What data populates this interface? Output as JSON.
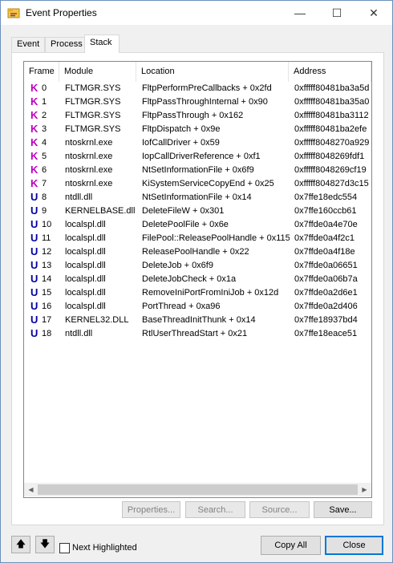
{
  "window": {
    "title": "Event Properties",
    "minimize_glyph": "—",
    "maximize_glyph": "☐",
    "close_glyph": "✕"
  },
  "tabs": [
    {
      "label": "Event",
      "active": false
    },
    {
      "label": "Process",
      "active": false
    },
    {
      "label": "Stack",
      "active": true
    }
  ],
  "list": {
    "columns": [
      "Frame",
      "Module",
      "Location",
      "Address"
    ],
    "rows": [
      {
        "mode": "K",
        "frame": "0",
        "module": "FLTMGR.SYS",
        "location": "FltpPerformPreCallbacks + 0x2fd",
        "address": "0xfffff80481ba3a5d"
      },
      {
        "mode": "K",
        "frame": "1",
        "module": "FLTMGR.SYS",
        "location": "FltpPassThroughInternal + 0x90",
        "address": "0xfffff80481ba35a0"
      },
      {
        "mode": "K",
        "frame": "2",
        "module": "FLTMGR.SYS",
        "location": "FltpPassThrough + 0x162",
        "address": "0xfffff80481ba3112"
      },
      {
        "mode": "K",
        "frame": "3",
        "module": "FLTMGR.SYS",
        "location": "FltpDispatch + 0x9e",
        "address": "0xfffff80481ba2efe"
      },
      {
        "mode": "K",
        "frame": "4",
        "module": "ntoskrnl.exe",
        "location": "IofCallDriver + 0x59",
        "address": "0xfffff8048270a929"
      },
      {
        "mode": "K",
        "frame": "5",
        "module": "ntoskrnl.exe",
        "location": "IopCallDriverReference + 0xf1",
        "address": "0xfffff8048269fdf1"
      },
      {
        "mode": "K",
        "frame": "6",
        "module": "ntoskrnl.exe",
        "location": "NtSetInformationFile + 0x6f9",
        "address": "0xfffff8048269cf19"
      },
      {
        "mode": "K",
        "frame": "7",
        "module": "ntoskrnl.exe",
        "location": "KiSystemServiceCopyEnd + 0x25",
        "address": "0xfffff804827d3c15"
      },
      {
        "mode": "U",
        "frame": "8",
        "module": "ntdll.dll",
        "location": "NtSetInformationFile + 0x14",
        "address": "0x7ffe18edc554"
      },
      {
        "mode": "U",
        "frame": "9",
        "module": "KERNELBASE.dll",
        "location": "DeleteFileW + 0x301",
        "address": "0x7ffe160ccb61"
      },
      {
        "mode": "U",
        "frame": "10",
        "module": "localspl.dll",
        "location": "DeletePoolFile + 0x6e",
        "address": "0x7ffde0a4e70e"
      },
      {
        "mode": "U",
        "frame": "11",
        "module": "localspl.dll",
        "location": "FilePool::ReleasePoolHandle + 0x115",
        "address": "0x7ffde0a4f2c1"
      },
      {
        "mode": "U",
        "frame": "12",
        "module": "localspl.dll",
        "location": "ReleasePoolHandle + 0x22",
        "address": "0x7ffde0a4f18e"
      },
      {
        "mode": "U",
        "frame": "13",
        "module": "localspl.dll",
        "location": "DeleteJob + 0x6f9",
        "address": "0x7ffde0a06651"
      },
      {
        "mode": "U",
        "frame": "14",
        "module": "localspl.dll",
        "location": "DeleteJobCheck + 0x1a",
        "address": "0x7ffde0a06b7a"
      },
      {
        "mode": "U",
        "frame": "15",
        "module": "localspl.dll",
        "location": "RemoveIniPortFromIniJob + 0x12d",
        "address": "0x7ffde0a2d6e1"
      },
      {
        "mode": "U",
        "frame": "16",
        "module": "localspl.dll",
        "location": "PortThread + 0xa96",
        "address": "0x7ffde0a2d406"
      },
      {
        "mode": "U",
        "frame": "17",
        "module": "KERNEL32.DLL",
        "location": "BaseThreadInitThunk + 0x14",
        "address": "0x7ffe18937bd4"
      },
      {
        "mode": "U",
        "frame": "18",
        "module": "ntdll.dll",
        "location": "RtlUserThreadStart + 0x21",
        "address": "0x7ffe18eace51"
      }
    ]
  },
  "panel_buttons": {
    "properties": "Properties...",
    "search": "Search...",
    "source": "Source...",
    "save": "Save..."
  },
  "bottom": {
    "up_glyph": "🡅",
    "down_glyph": "🡇",
    "next_highlighted": "Next Highlighted",
    "next_highlighted_checked": false,
    "copy_all": "Copy All",
    "close": "Close"
  },
  "colors": {
    "kernel_mode": "#c000c0",
    "user_mode": "#0000a0",
    "default_button_border": "#0078d7"
  }
}
